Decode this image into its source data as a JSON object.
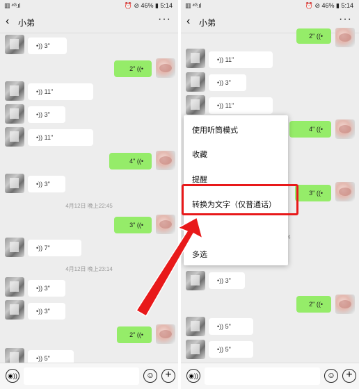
{
  "status": {
    "signal": "▥ ⁴ᴳ.ıl",
    "alarm_battery_time": "⏰ ⊘ 46% ▮ 5:14"
  },
  "header": {
    "back_icon": "‹",
    "title": "小弟",
    "more_icon": "···"
  },
  "left": {
    "timestamps": [
      "4月12日 晚上22:45",
      "4月12日 晚上23:14"
    ],
    "messages": [
      "3\"",
      "2\"",
      "11\"",
      "3\"",
      "11\"",
      "4\"",
      "3\"",
      "3\"",
      "7\"",
      "3\"",
      "3\"",
      "2\"",
      "5\""
    ]
  },
  "right": {
    "messages": [
      "2\"",
      "11\"",
      "3\"",
      "11\"",
      "4\"",
      "3\"",
      "3\"",
      "2\"",
      "5\"",
      "5\""
    ],
    "partial_timestamp_digits": [
      "5",
      "4"
    ],
    "menu": {
      "items": [
        "使用听筒模式",
        "收藏",
        "提醒",
        "转换为文字（仅普通话）",
        "多选"
      ],
      "partial_item": "除"
    }
  },
  "icons": {
    "voice_in": "•))",
    "voice_out": "((•",
    "input_voice": "◉))",
    "emoji": "☺",
    "plus": "+"
  },
  "colors": {
    "my_bubble": "#95ec69",
    "highlight": "#e8191a"
  }
}
